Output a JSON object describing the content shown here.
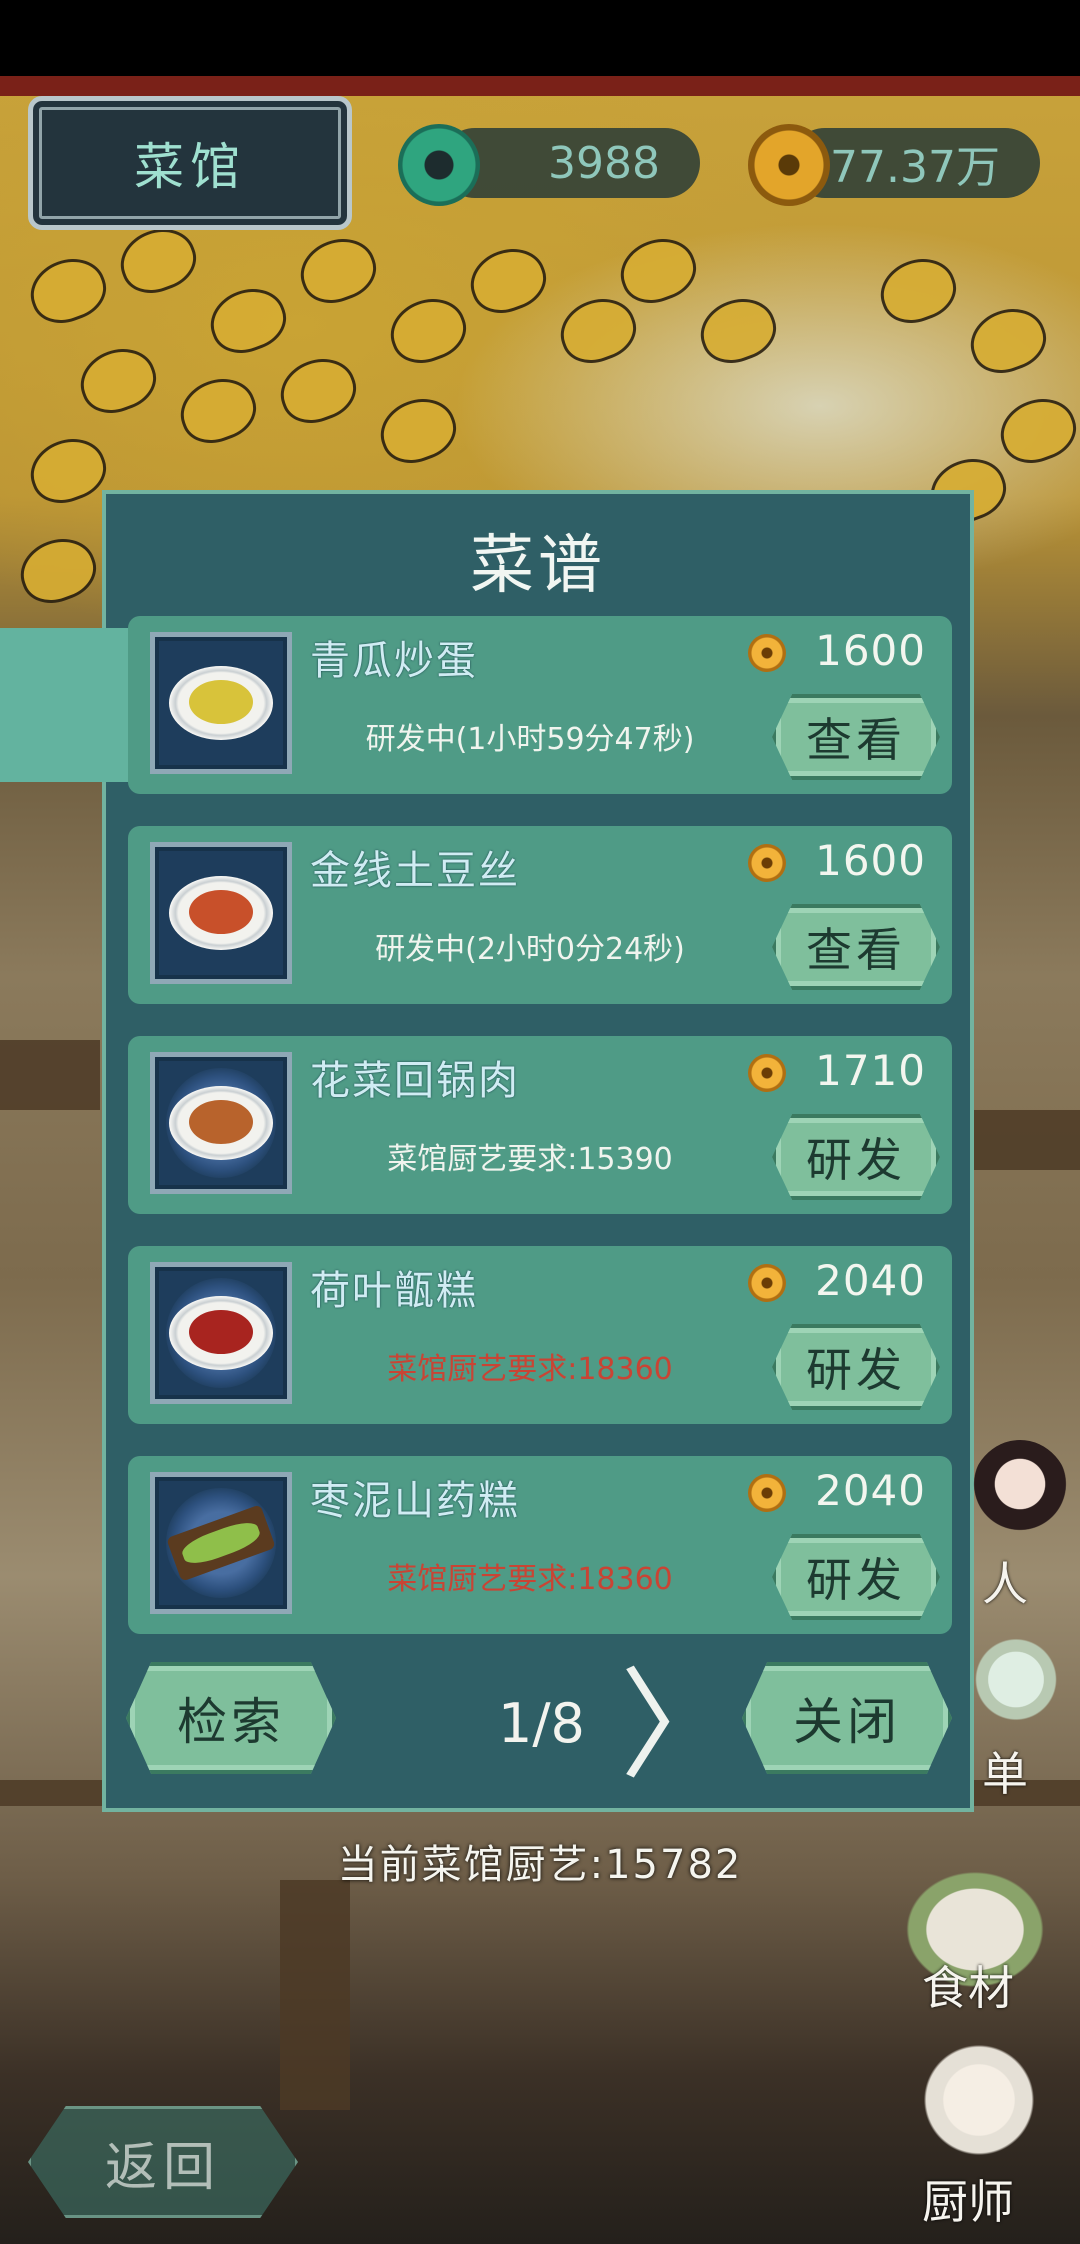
{
  "header": {
    "title": "菜馆",
    "jade_amount": "3988",
    "coin_amount": "77.37万"
  },
  "dialog": {
    "title": "菜谱",
    "recipes": [
      {
        "name": "青瓜炒蛋",
        "price": "1600",
        "status": "研发中(1小时59分47秒)",
        "status_color": "#f0f4ee",
        "button": "查看",
        "food_color": "#d8c33a"
      },
      {
        "name": "金线土豆丝",
        "price": "1600",
        "status": "研发中(2小时0分24秒)",
        "status_color": "#f0f4ee",
        "button": "查看",
        "food_color": "#c8502a"
      },
      {
        "name": "花菜回锅肉",
        "price": "1710",
        "status": "菜馆厨艺要求:15390",
        "status_color": "#f0f4ee",
        "button": "研发",
        "food_color": "#b8632c"
      },
      {
        "name": "荷叶甑糕",
        "price": "2040",
        "status": "菜馆厨艺要求:18360",
        "status_color": "#c94434",
        "button": "研发",
        "food_color": "#a8241f"
      },
      {
        "name": "枣泥山药糕",
        "price": "2040",
        "status": "菜馆厨艺要求:18360",
        "status_color": "#c94434",
        "button": "研发",
        "food_color": "#6e4a26"
      }
    ],
    "search_label": "检索",
    "page_indicator": "1/8",
    "close_label": "关闭"
  },
  "current_skill": "当前菜馆厨艺:15782",
  "side_menu": {
    "person_label": "人",
    "menu_label": "单",
    "ingredients_label": "食材",
    "chef_label": "厨师"
  },
  "back_label": "返回"
}
